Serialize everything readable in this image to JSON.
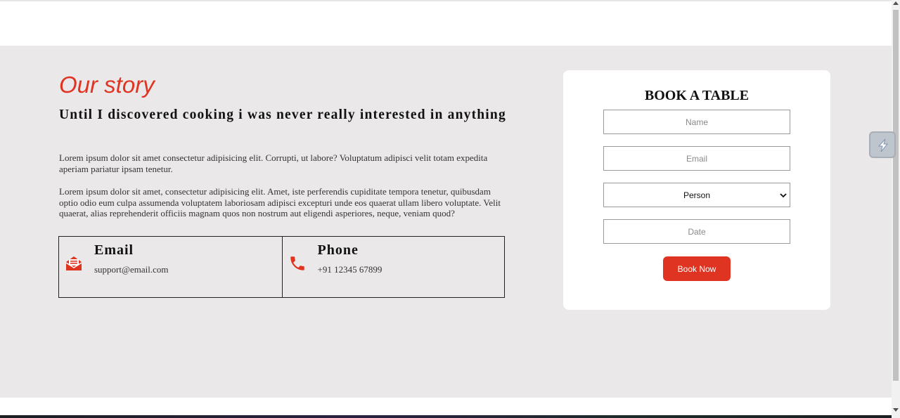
{
  "story": {
    "title": "Our story",
    "heading": "Until I discovered cooking i was never really interested in anything",
    "paragraph1": "Lorem ipsum dolor sit amet consectetur adipisicing elit. Corrupti, ut labore? Voluptatum adipisci velit totam expedita aperiam pariatur ipsam tenetur.",
    "paragraph2": "Lorem ipsum dolor sit amet, consectetur adipisicing elit. Amet, iste perferendis cupiditate tempora tenetur, quibusdam optio odio eum culpa assumenda voluptatem laboriosam adipisci excepturi unde eos quaerat ullam libero voluptate. Velit quaerat, alias reprehenderit officiis magnam quos non nostrum aut eligendi asperiores, neque, veniam quod?"
  },
  "contacts": [
    {
      "title": "Email",
      "value": "support@email.com",
      "icon": "envelope-open-icon"
    },
    {
      "title": "Phone",
      "value": "+91 12345 67899",
      "icon": "phone-icon"
    }
  ],
  "booking": {
    "title": "BOOK A TABLE",
    "name_placeholder": "Name",
    "email_placeholder": "Email",
    "person_selected": "Person",
    "date_placeholder": "Date",
    "button_label": "Book Now"
  },
  "colors": {
    "accent": "#e03423",
    "section_background": "#eae8e9",
    "card_background": "#ffffff"
  },
  "extension": {
    "icon": "lightning-bolt-icon"
  }
}
